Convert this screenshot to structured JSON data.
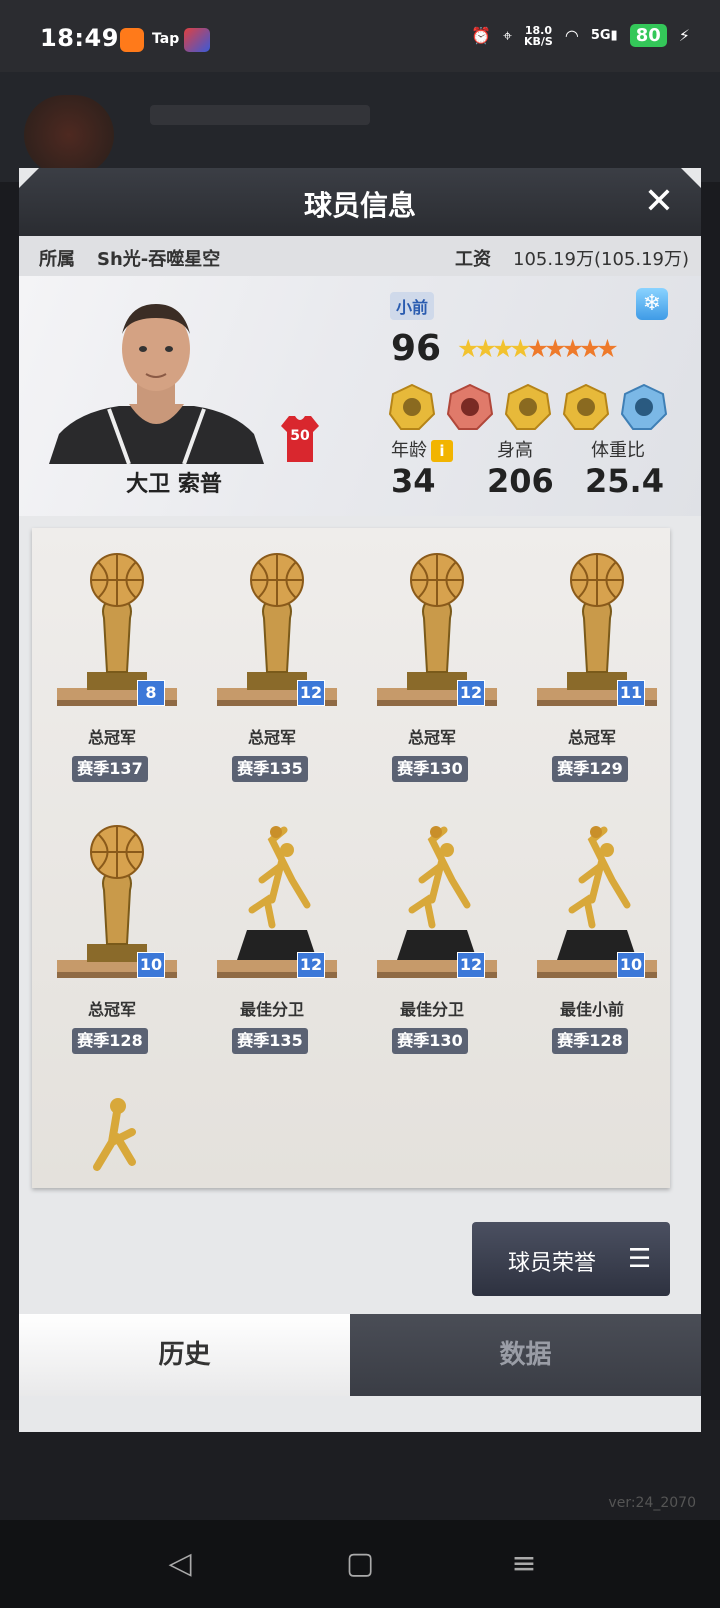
{
  "status": {
    "time": "18:49",
    "tap": "Tap",
    "speed_top": "18.0",
    "speed_unit": "KB/S",
    "network": "5G",
    "battery": "80"
  },
  "version": "ver:24_2070",
  "modal": {
    "title": "球员信息",
    "close": "✕"
  },
  "info": {
    "affiliation_label": "所属",
    "affiliation_value": "Sh光-吞噬星空",
    "salary_label": "工资",
    "salary_value": "105.19万(105.19万)"
  },
  "player": {
    "name": "大卫 索普",
    "position": "小前",
    "jersey_number": "50",
    "rating": "96",
    "stars": {
      "gold": 4,
      "orange": 5
    },
    "age_label": "年龄",
    "age": "34",
    "height_label": "身高",
    "height": "206",
    "weight_label": "体重比",
    "weight": "25.4",
    "skill_icons": [
      "skill-badge-icon",
      "skill-badge-icon",
      "skill-badge-icon",
      "skill-badge-icon",
      "skill-badge-icon"
    ]
  },
  "trophies": [
    {
      "name": "总冠军",
      "level": "8",
      "season": "赛季137",
      "kind": "ball"
    },
    {
      "name": "总冠军",
      "level": "12",
      "season": "赛季135",
      "kind": "ball"
    },
    {
      "name": "总冠军",
      "level": "12",
      "season": "赛季130",
      "kind": "ball"
    },
    {
      "name": "总冠军",
      "level": "11",
      "season": "赛季129",
      "kind": "ball"
    },
    {
      "name": "总冠军",
      "level": "10",
      "season": "赛季128",
      "kind": "ball"
    },
    {
      "name": "最佳分卫",
      "level": "12",
      "season": "赛季135",
      "kind": "player"
    },
    {
      "name": "最佳分卫",
      "level": "12",
      "season": "赛季130",
      "kind": "player"
    },
    {
      "name": "最佳小前",
      "level": "10",
      "season": "赛季128",
      "kind": "player"
    }
  ],
  "honor_button": "球员荣誉",
  "tabs": {
    "history": "历史",
    "data": "数据"
  }
}
